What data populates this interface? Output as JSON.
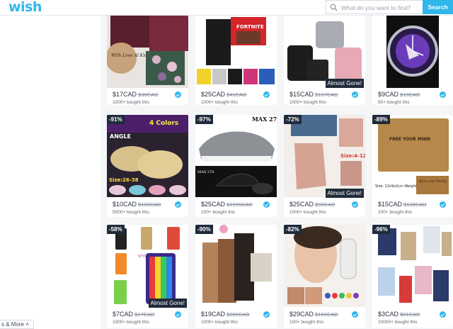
{
  "header": {
    "logo": "wish",
    "search_placeholder": "What do you want to find?",
    "search_button": "Search"
  },
  "sidebar": {
    "more_label": "s & More ˄"
  },
  "products": [
    {
      "price": "$17CAD",
      "old_price": "$30CAD",
      "sold": "1000+ bought this",
      "discount": "",
      "badge": ""
    },
    {
      "price": "$25CAD",
      "old_price": "$41CAD",
      "sold": "1000+ bought this",
      "discount": "",
      "badge": ""
    },
    {
      "price": "$15CAD",
      "old_price": "$107CAD",
      "sold": "1000+ bought this",
      "discount": "",
      "badge": "Almost Gone!"
    },
    {
      "price": "$9CAD",
      "old_price": "$13CAD",
      "sold": "50+ bought this",
      "discount": "",
      "badge": ""
    },
    {
      "price": "$10CAD",
      "old_price": "$120CAD",
      "sold": "5000+ bought this",
      "discount": "-91%",
      "badge": ""
    },
    {
      "price": "$25CAD",
      "old_price": "$1996CAD",
      "sold": "100+ bought this",
      "discount": "-97%",
      "badge": ""
    },
    {
      "price": "$25CAD",
      "old_price": "$92CAD",
      "sold": "1000+ bought this",
      "discount": "-72%",
      "badge": "Almost Gone!"
    },
    {
      "price": "$15CAD",
      "old_price": "$138CAD",
      "sold": "100+ bought this",
      "discount": "-89%",
      "badge": ""
    },
    {
      "price": "$7CAD",
      "old_price": "$17CAD",
      "sold": "1000+ bought this",
      "discount": "-58%",
      "badge": "Almost Gone!"
    },
    {
      "price": "$19CAD",
      "old_price": "$202CAD",
      "sold": "1000+ bought this",
      "discount": "-90%",
      "badge": ""
    },
    {
      "price": "$29CAD",
      "old_price": "$162CAD",
      "sold": "100+ bought this",
      "discount": "-82%",
      "badge": ""
    },
    {
      "price": "$3CAD",
      "old_price": "$81CAD",
      "sold": "20000+ bought this",
      "discount": "-96%",
      "badge": ""
    }
  ],
  "image_text": {
    "p1": "With Love Al Kids",
    "p2": "FORTNITE",
    "p5": "4 Colors",
    "p5b": "ANGLE",
    "p5c": "Size:26-38",
    "p6": "MAX 270",
    "p6b": "MAX 270",
    "p7": "Size:4-12",
    "p8a": "FREE YOUR MIND",
    "p8b": "Size: 12x9x2cm Weight: 60g",
    "p8c": "Rick and Morty",
    "p9": "STYLE 1"
  },
  "colors": {
    "accent": "#2fb7ec",
    "badge_bg": "#1f2b3a"
  }
}
